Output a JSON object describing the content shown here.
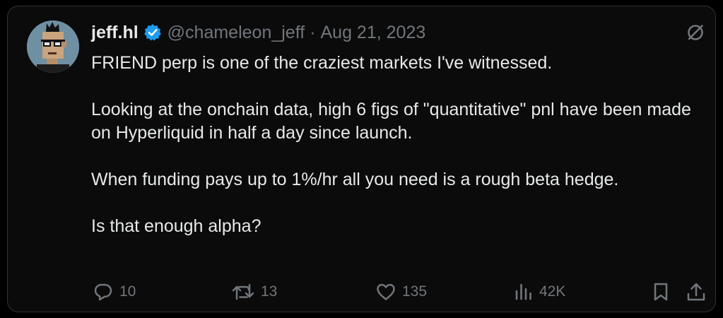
{
  "author": {
    "name": "jeff.hl",
    "handle": "@chameleon_jeff",
    "date": "Aug 21, 2023",
    "verified": true,
    "avatar": "pixel-art-avatar"
  },
  "post": {
    "paragraphs": [
      "FRIEND perp is one of the craziest markets I've witnessed.",
      "Looking at the onchain data, high 6 figs of \"quantitative\" pnl have been made on Hyperliquid in half a day since launch.",
      "When funding pays up to 1%/hr all you need is a rough beta hedge.",
      "Is that enough alpha?"
    ]
  },
  "actions": {
    "reply": {
      "icon": "reply-icon",
      "count": "10"
    },
    "repost": {
      "icon": "repost-icon",
      "count": "13"
    },
    "like": {
      "icon": "heart-icon",
      "count": "135"
    },
    "views": {
      "icon": "views-icon",
      "count": "42K"
    },
    "bookmark": {
      "icon": "bookmark-icon"
    },
    "share": {
      "icon": "share-icon"
    }
  },
  "colors": {
    "background": "#000000",
    "card": "#0b0b0b",
    "text": "#e7e9ea",
    "muted": "#71767b",
    "verified": "#1d9bf0"
  }
}
